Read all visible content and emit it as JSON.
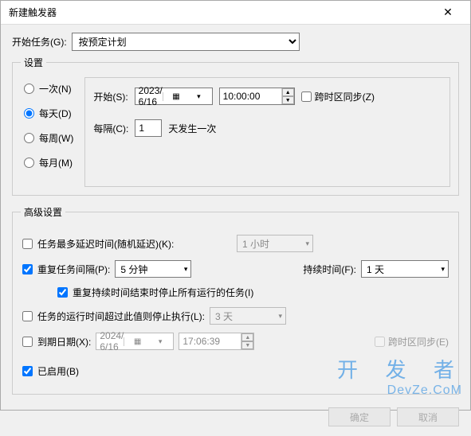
{
  "window": {
    "title": "新建触发器"
  },
  "header": {
    "start_task_label": "开始任务(G):",
    "start_task_value": "按预定计划"
  },
  "settings": {
    "legend": "设置",
    "radios": {
      "once": "一次(N)",
      "daily": "每天(D)",
      "weekly": "每周(W)",
      "monthly": "每月(M)"
    },
    "start_label": "开始(S):",
    "start_date": "2023/ 6/16",
    "start_time": "10:00:00",
    "tz_sync_label": "跨时区同步(Z)",
    "interval_label": "每隔(C):",
    "interval_value": "1",
    "interval_suffix": "天发生一次"
  },
  "advanced": {
    "legend": "高级设置",
    "delay_label": "任务最多延迟时间(随机延迟)(K):",
    "delay_value": "1 小时",
    "repeat_label": "重复任务间隔(P):",
    "repeat_value": "5 分钟",
    "duration_label": "持续时间(F):",
    "duration_value": "1 天",
    "stop_end_label": "重复持续时间结束时停止所有运行的任务(I)",
    "stop_over_label": "任务的运行时间超过此值则停止执行(L):",
    "stop_over_value": "3 天",
    "expire_label": "到期日期(X):",
    "expire_date": "2024/ 6/16",
    "expire_time": "17:06:39",
    "expire_tz_label": "跨时区同步(E)",
    "enabled_label": "已启用(B)"
  },
  "footer": {
    "ok": "确定",
    "cancel": "取消"
  },
  "watermark": {
    "big": "开 发 者",
    "small": "DevZe.CoM"
  }
}
